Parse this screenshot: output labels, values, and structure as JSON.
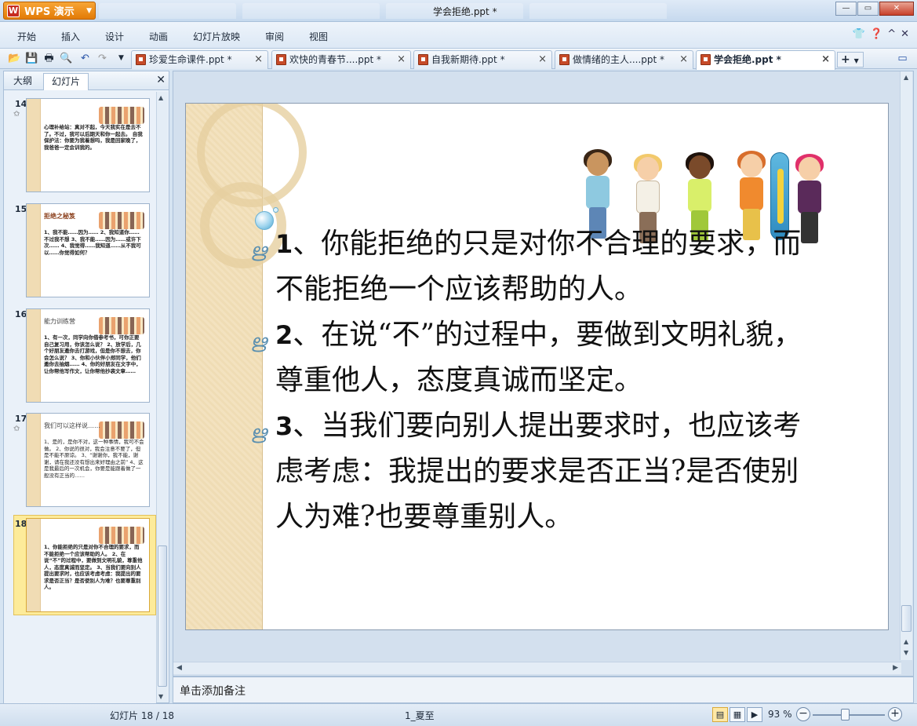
{
  "app": {
    "brand": "WPS 演示",
    "window_title": "学会拒绝.ppt *"
  },
  "menu": [
    "开始",
    "插入",
    "设计",
    "动画",
    "幻灯片放映",
    "审阅",
    "视图"
  ],
  "doc_tabs": [
    {
      "label": "珍爱生命课件.ppt *"
    },
    {
      "label": "欢快的青春节....ppt *"
    },
    {
      "label": "自我新期待.ppt *"
    },
    {
      "label": "做情绪的主人....ppt *"
    },
    {
      "label": "学会拒绝.ppt *",
      "active": true
    }
  ],
  "panel": {
    "tabs": [
      "大纲",
      "幻灯片"
    ],
    "active_tab": "幻灯片"
  },
  "thumbnails": [
    {
      "num": "14",
      "starred": true,
      "title": "",
      "text": "心理补给站：真对不起，今天我实在是去不了。不过，我可以后期天和你一起去。 自我保护法：你要为我着想吗，我是回家晚了，我爸爸一定会训我的。"
    },
    {
      "num": "15",
      "starred": false,
      "title": "拒绝之秘笈",
      "text": "1、我不能……因为…… 2、我知道你……不过我不想 3、我不能……因为……或许下次…… 4、我觉得……我知道……从不我可以……你觉得如何？"
    },
    {
      "num": "16",
      "starred": false,
      "title": "能力训练营",
      "text": "1、有一次，同学向你借参考书，可你正要自己复习用，你该怎么说？ 2、放学后，几个好朋友邀你去打游戏，但是你不想去，你会怎么说？ 3、你和小伙伴小郑同学，他们邀你去抽烟…… 4、你的好朋友在文字中，让你帮他写作文，让你帮他抄袭文章……"
    },
    {
      "num": "17",
      "starred": true,
      "title": "我们可以这样说……",
      "text": "1、是的，是你不对，这一种事情，我可不会做。 2、你说的很对，我会注意不要了，但是不能不原谅。 3、“谢谢你，我不能，谢谢，请在我还没有想出来好理由之前” 4、这是我最后的一次机会，你要是能跟着做了一般没有正当的……"
    },
    {
      "num": "18",
      "starred": false,
      "selected": true,
      "title": "",
      "text": "1、你能拒绝的只是对你不合理的要求，而不能拒绝一个应该帮助的人。 2、在说“不”的过程中，要做到文明礼貌，尊重他人，态度真诚而坚定。 3、当我们要向别人提出要求时，也应该考虑考虑：我提出的要求是否正当？是否使别人为难？也要尊重别人。"
    }
  ],
  "slide": {
    "points": [
      {
        "num": "1",
        "text": "、你能拒绝的只是对你不合理的要求，而不能拒绝一个应该帮助的人。"
      },
      {
        "num": "2",
        "text": "、在说“不”的过程中，要做到文明礼貌，尊重他人，态度真诚而坚定。"
      },
      {
        "num": "3",
        "text": "、当我们要向别人提出要求时，也应该考虑考虑：我提出的要求是否正当?是否使别人为难?也要尊重别人。"
      }
    ]
  },
  "notes": {
    "placeholder": "单击添加备注"
  },
  "status": {
    "slide_indicator": "幻灯片 18 / 18",
    "theme": "1_夏至",
    "zoom": "93 %"
  },
  "icons": [
    "wps-logo-icon",
    "open-icon",
    "save-icon",
    "print-icon",
    "print-preview-icon",
    "undo-icon",
    "redo-icon",
    "ppt-file-icon",
    "help-icon",
    "close-icon"
  ]
}
